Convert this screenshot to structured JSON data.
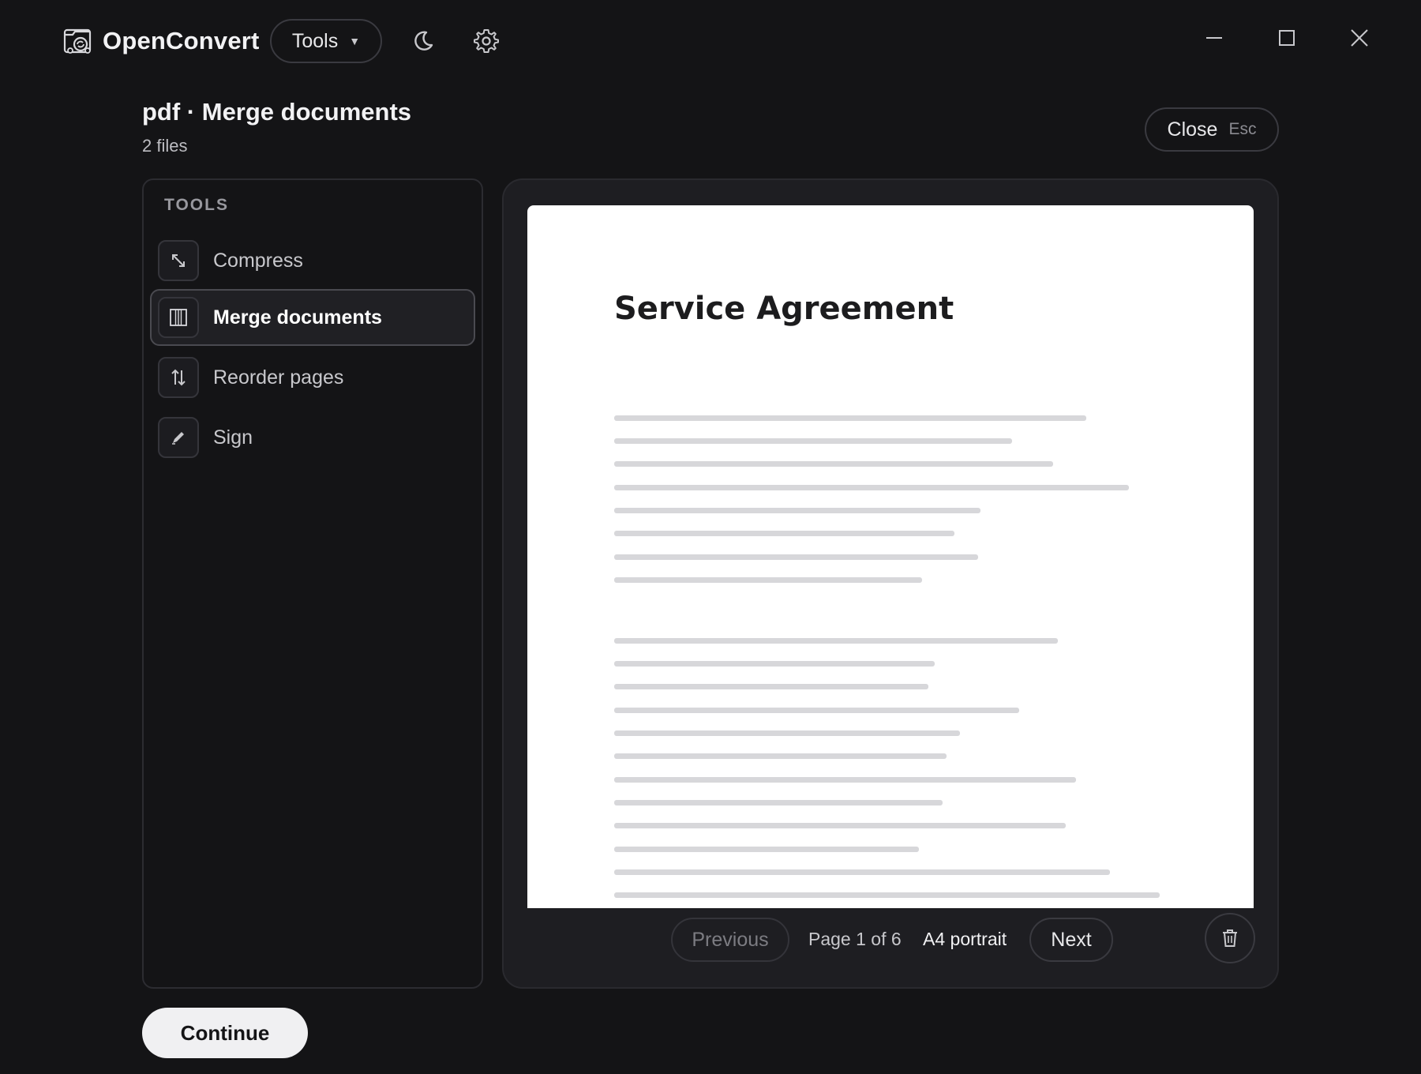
{
  "app": {
    "name": "OpenConvert",
    "tools_menu_label": "Tools"
  },
  "header": {
    "title": "pdf · Merge documents",
    "subtitle": "2 files",
    "close_label": "Close",
    "close_shortcut": "Esc"
  },
  "sidebar": {
    "heading": "TOOLS",
    "items": [
      {
        "label": "Compress",
        "icon": "compress-icon",
        "active": false
      },
      {
        "label": "Merge documents",
        "icon": "merge-columns-icon",
        "active": true
      },
      {
        "label": "Reorder pages",
        "icon": "reorder-arrows-icon",
        "active": false
      },
      {
        "label": "Sign",
        "icon": "pen-icon",
        "active": false
      }
    ]
  },
  "preview": {
    "document_title": "Service Agreement",
    "pager": {
      "previous_label": "Previous",
      "page_info": "Page 1 of 6",
      "page_size": "A4 portrait",
      "next_label": "Next"
    }
  },
  "footer": {
    "continue_label": "Continue"
  },
  "colors": {
    "background": "#141416",
    "panel": "#1e1e22",
    "border": "#3a3a40",
    "continue_button": "#f0f0f2",
    "page": "#ffffff"
  }
}
